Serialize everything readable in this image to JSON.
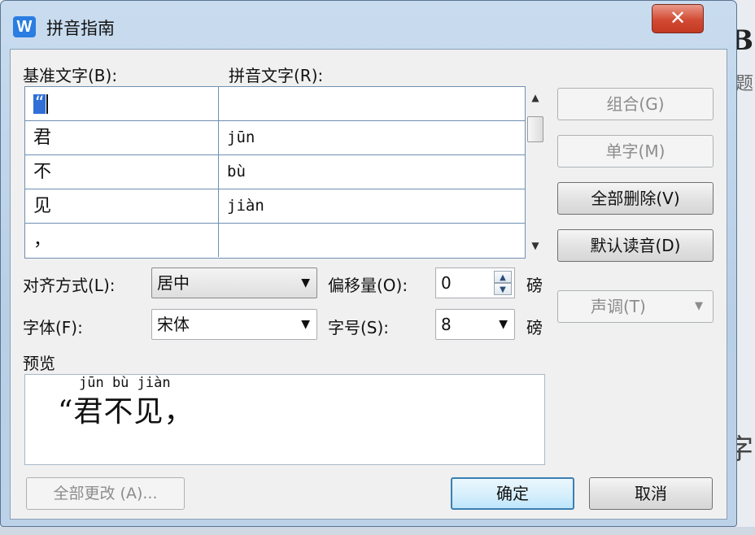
{
  "window": {
    "title": "拼音指南",
    "logo_letter": "W",
    "close_glyph": "✕"
  },
  "labels": {
    "base_text": "基准文字(B):",
    "pinyin_text": "拼音文字(R):",
    "alignment": "对齐方式(L):",
    "offset": "偏移量(O):",
    "font": "字体(F):",
    "font_size": "字号(S):",
    "unit_offset": "磅",
    "unit_size": "磅",
    "preview": "预览"
  },
  "grid": {
    "rows": [
      {
        "base": "“",
        "pinyin": "",
        "selected": true
      },
      {
        "base": "君",
        "pinyin": "jūn"
      },
      {
        "base": "不",
        "pinyin": "bù"
      },
      {
        "base": "见",
        "pinyin": "jiàn"
      },
      {
        "base": "，",
        "pinyin": ""
      }
    ]
  },
  "controls": {
    "alignment_value": "居中",
    "font_value": "宋体",
    "offset_value": "0",
    "size_value": "8"
  },
  "buttons": {
    "group": "组合(G)",
    "single": "单字(M)",
    "delete_all": "全部删除(V)",
    "default_reading": "默认读音(D)",
    "tone": "声调(T)",
    "change_all": "全部更改 (A)...",
    "ok": "确定",
    "cancel": "取消"
  },
  "preview": {
    "pinyin": "jūn bù jiàn",
    "text": "“君不见，"
  },
  "background_doc": {
    "glyph_top": "B",
    "glyph_mid": "题",
    "glyph_bottom": "字"
  },
  "colors": {
    "selection": "#2f6fd6",
    "close_button": "#d24a33",
    "frame": "#c9dcef",
    "default_button_border": "#3c7fb1"
  },
  "icons": [
    "app-logo-icon",
    "close-icon",
    "scroll-up-icon",
    "scroll-down-icon",
    "dropdown-arrow-icon",
    "spin-up-icon",
    "spin-down-icon"
  ]
}
